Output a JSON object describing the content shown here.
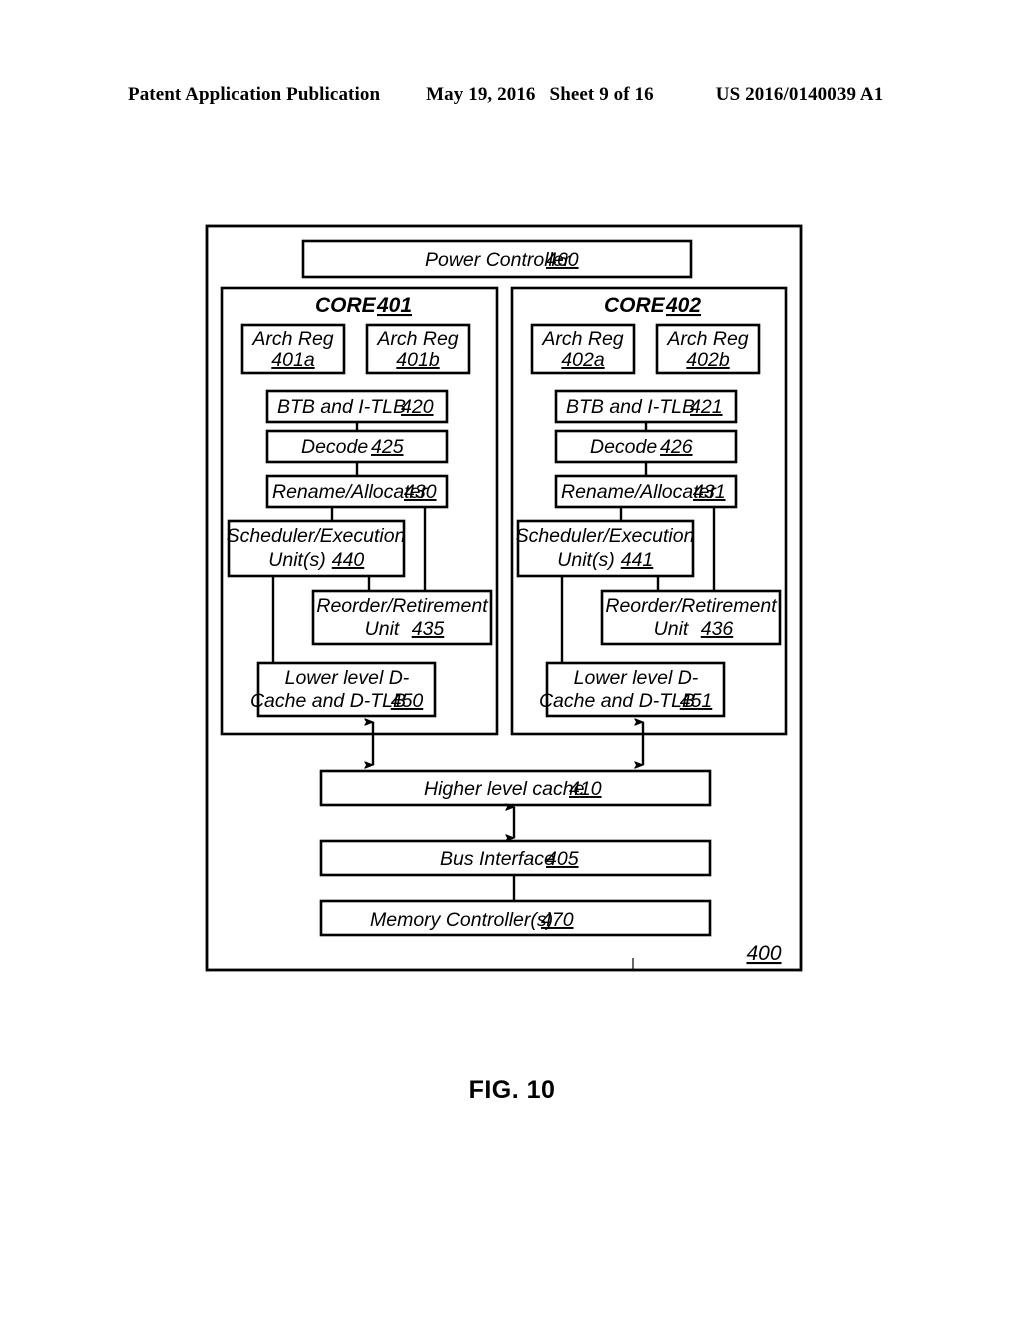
{
  "header": {
    "publication": "Patent Application Publication",
    "date": "May 19, 2016",
    "sheet": "Sheet 9 of 16",
    "patent_number": "US 2016/0140039 A1"
  },
  "figure": {
    "caption": "FIG. 10",
    "system_ref": "400",
    "power_controller": {
      "label": "Power Controller",
      "ref": "460"
    },
    "cores": [
      {
        "title": "CORE",
        "ref": "401",
        "arch_regs": [
          {
            "label": "Arch Reg",
            "ref": "401a"
          },
          {
            "label": "Arch Reg",
            "ref": "401b"
          }
        ],
        "btb": {
          "label": "BTB and I-TLB",
          "ref": "420"
        },
        "decode": {
          "label": "Decode",
          "ref": "425"
        },
        "rename": {
          "label": "Rename/Allocater",
          "ref": "430"
        },
        "scheduler": {
          "line1": "Scheduler/Execution",
          "line2": "Unit(s)",
          "ref": "440"
        },
        "reorder": {
          "line1": "Reorder/Retirement",
          "line2": "Unit",
          "ref": "435"
        },
        "dcache": {
          "line1": "Lower level D-",
          "line2": "Cache and D-TLB",
          "ref": "450"
        }
      },
      {
        "title": "CORE",
        "ref": "402",
        "arch_regs": [
          {
            "label": "Arch Reg",
            "ref": "402a"
          },
          {
            "label": "Arch Reg",
            "ref": "402b"
          }
        ],
        "btb": {
          "label": "BTB and I-TLB",
          "ref": "421"
        },
        "decode": {
          "label": "Decode",
          "ref": "426"
        },
        "rename": {
          "label": "Rename/Allocater",
          "ref": "431"
        },
        "scheduler": {
          "line1": "Scheduler/Execution",
          "line2": "Unit(s)",
          "ref": "441"
        },
        "reorder": {
          "line1": "Reorder/Retirement",
          "line2": "Unit",
          "ref": "436"
        },
        "dcache": {
          "line1": "Lower level D-",
          "line2": "Cache and D-TLB",
          "ref": "451"
        }
      }
    ],
    "shared": [
      {
        "label": "Higher level cache",
        "ref": "410"
      },
      {
        "label": "Bus Interface",
        "ref": "405"
      },
      {
        "label": "Memory Controller(s)",
        "ref": "470"
      }
    ]
  }
}
